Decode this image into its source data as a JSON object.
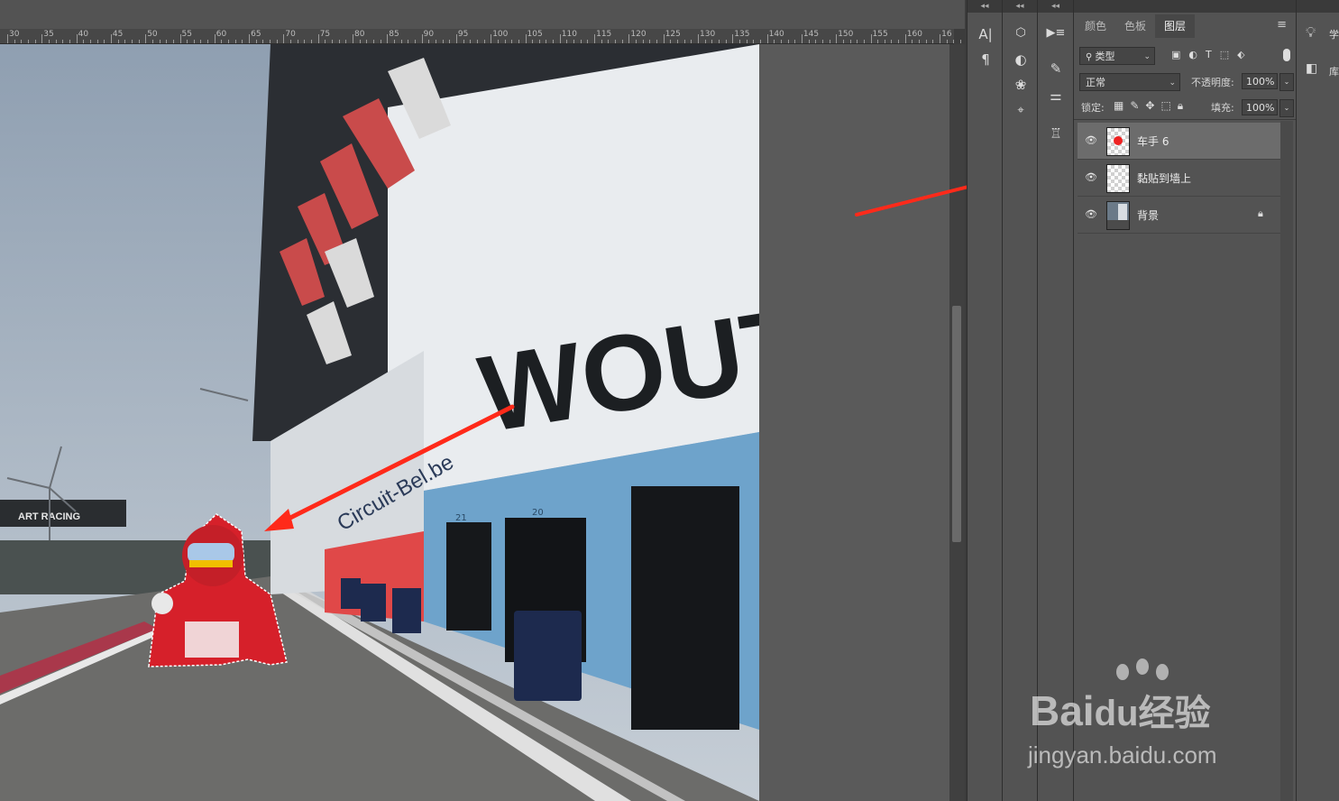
{
  "ruler": {
    "labels": [
      "30",
      "35",
      "40",
      "45",
      "50",
      "55",
      "60",
      "65",
      "70",
      "75",
      "80",
      "85",
      "90",
      "95",
      "100",
      "105",
      "110",
      "115",
      "120",
      "125",
      "130",
      "135",
      "140",
      "145",
      "150",
      "155",
      "160",
      "16"
    ]
  },
  "tools": {
    "column_a": [
      "character-icon",
      "paragraph-icon"
    ],
    "column_b": [
      "3d-icon",
      "adjustments-icon",
      "channels-icon",
      "paths-icon"
    ],
    "column_c": [
      "actions-icon",
      "brush-icon",
      "sliders-icon",
      "clone-source-icon"
    ]
  },
  "panel": {
    "tabs": [
      "颜色",
      "色板",
      "图层"
    ],
    "active_tab": "图层",
    "filter_label": "类型",
    "blend_mode": "正常",
    "opacity_label": "不透明度:",
    "opacity_value": "100%",
    "lock_label": "锁定:",
    "fill_label": "填充:",
    "fill_value": "100%",
    "layers": [
      {
        "name": "车手 6",
        "selected": true
      },
      {
        "name": "黏贴到墙上",
        "selected": false
      },
      {
        "name": "背景",
        "selected": false,
        "locked": true
      }
    ]
  },
  "right_strip": {
    "items": [
      "学",
      "库"
    ]
  },
  "photo": {
    "banner_text": "WOUTIZ",
    "wall_text": "Circuit-Bel.be",
    "billboard_text": "ART RACING",
    "garage_numbers": [
      "21",
      "20"
    ]
  },
  "watermark": {
    "brand": "Bai",
    "brand2": "du",
    "brand_cn": "经验",
    "url": "jingyan.baidu.com"
  },
  "colors": {
    "arrow": "#ff2a1a",
    "panel_bg": "#535353",
    "selected_row": "#6c6c6c"
  }
}
